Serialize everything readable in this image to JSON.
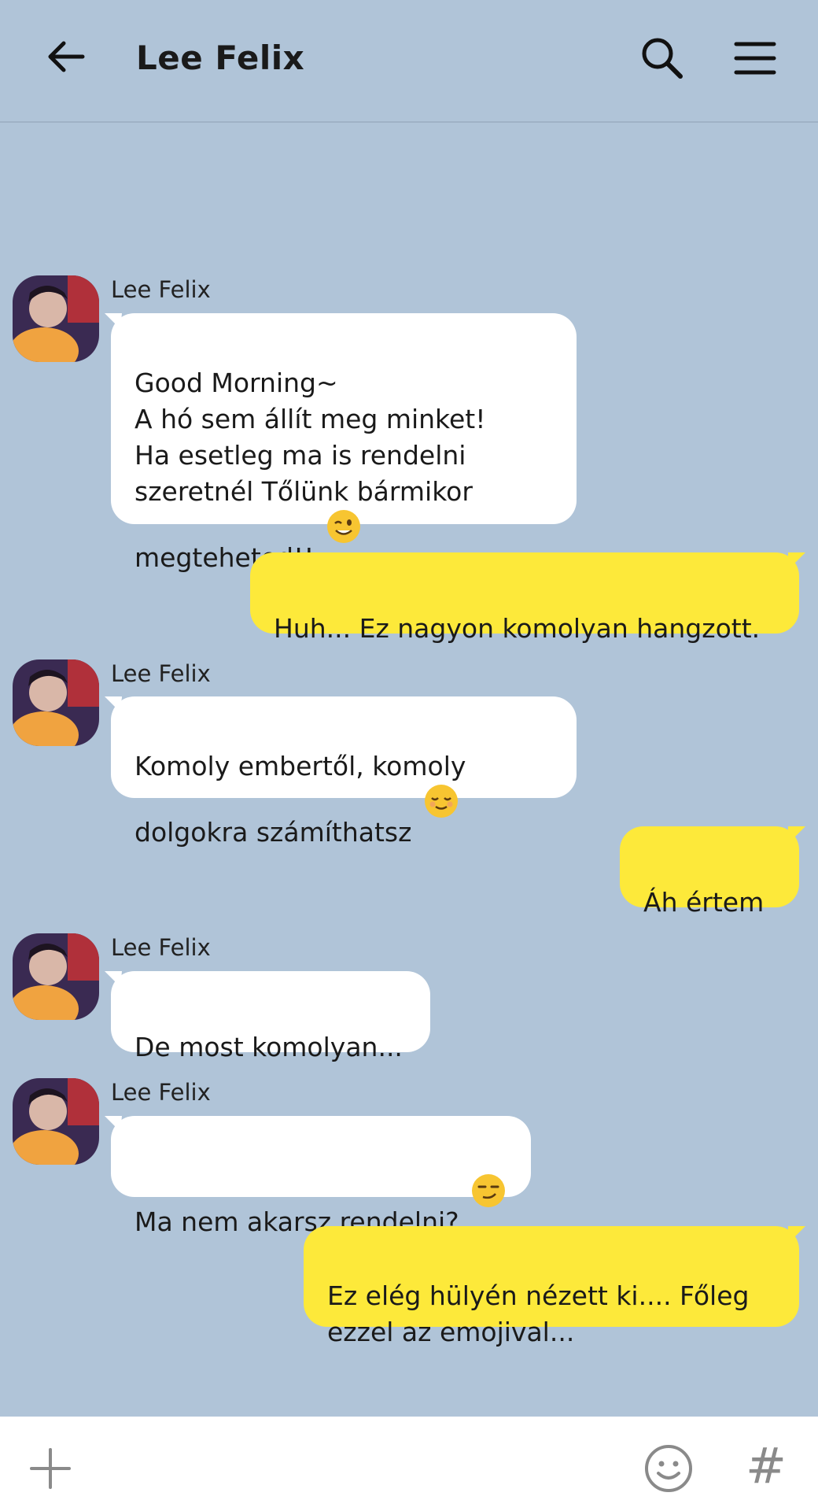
{
  "header": {
    "title": "Lee Felix",
    "back_icon": "arrow-left-icon",
    "search_icon": "search-icon",
    "menu_icon": "hamburger-menu-icon"
  },
  "colors": {
    "background": "#b0c4d8",
    "incoming_bubble": "#ffffff",
    "outgoing_bubble": "#fde93a"
  },
  "messages": [
    {
      "direction": "in",
      "sender": "Lee Felix",
      "text": "Good Morning~\nA hó sem állít meg minket!\nHa esetleg ma is rendelni\nszeretnél Tőlünk bármikor\nmegteheted!! ",
      "emoji": "winking-face"
    },
    {
      "direction": "out",
      "text": "Huh... Ez nagyon komolyan hangzott."
    },
    {
      "direction": "in",
      "sender": "Lee Felix",
      "text": "Komoly embertől, komoly\ndolgokra számíthatsz ",
      "emoji": "relieved-face"
    },
    {
      "direction": "out",
      "text": "Áh értem"
    },
    {
      "direction": "in",
      "sender": "Lee Felix",
      "text": "De most komolyan..."
    },
    {
      "direction": "in",
      "sender": "Lee Felix",
      "text": "Ma nem akarsz rendelni? ",
      "emoji": "smirking-face"
    },
    {
      "direction": "out",
      "text": "Ez elég hülyén nézett ki.... Főleg\nezzel az emojival..."
    }
  ],
  "input_bar": {
    "plus_icon": "plus-icon",
    "emoji_icon": "smiley-icon",
    "hash_label": "#"
  }
}
